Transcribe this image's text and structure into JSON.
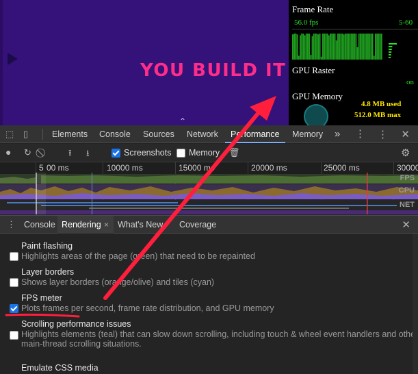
{
  "page": {
    "hero_text": "YOU BUILD IT"
  },
  "fps_meter": {
    "frame_rate_title": "Frame Rate",
    "fps_value": "56.0 fps",
    "fps_range": "5-60",
    "gpu_raster_title": "GPU Raster",
    "gpu_raster_status": "on",
    "gpu_memory_title": "GPU Memory",
    "memory_used": "4.8 MB used",
    "memory_max": "512.0 MB max",
    "fps_history": [
      59,
      60,
      60,
      59,
      34,
      58,
      60,
      60,
      58,
      60,
      60,
      60,
      35,
      57,
      60,
      60,
      60,
      59,
      60,
      33,
      60,
      60,
      60,
      60,
      58,
      60,
      60,
      60,
      60,
      52,
      60,
      60,
      60,
      60,
      59,
      60,
      60,
      60,
      60,
      60,
      60,
      60,
      60,
      44,
      60,
      60,
      60,
      60,
      60,
      60,
      60,
      60,
      60,
      60,
      34,
      60,
      60,
      60,
      60,
      60
    ]
  },
  "devtools": {
    "tabs": [
      {
        "label": "Elements"
      },
      {
        "label": "Console"
      },
      {
        "label": "Sources"
      },
      {
        "label": "Network"
      },
      {
        "label": "Performance"
      },
      {
        "label": "Memory"
      }
    ],
    "more_tabs": "»",
    "active_tab": "Performance"
  },
  "performance": {
    "screenshots_label": "Screenshots",
    "screenshots_checked": true,
    "memory_label": "Memory",
    "memory_checked": false,
    "timeline_ticks": [
      "5",
      "00 ms",
      "10000 ms",
      "15000 ms",
      "20000 ms",
      "25000 ms",
      "30000"
    ],
    "overview_labels": [
      "FPS",
      "CPU",
      "NET"
    ]
  },
  "drawer": {
    "tabs": [
      {
        "label": "Console"
      },
      {
        "label": "Rendering"
      },
      {
        "label": "What's New"
      },
      {
        "label": "Coverage"
      }
    ],
    "active_tab": "Rendering",
    "close_tab_glyph": "×"
  },
  "rendering": {
    "options": [
      {
        "title": "Paint flashing",
        "desc": [
          "Highlights areas of the page (green) that need to be repainted"
        ],
        "checked": false
      },
      {
        "title": "Layer borders",
        "desc": [
          "Shows layer borders (orange/olive) and tiles (cyan)"
        ],
        "checked": false
      },
      {
        "title": "FPS meter",
        "desc": [
          "Plots frames per second, frame rate distribution, and GPU memory"
        ],
        "checked": true
      },
      {
        "title": "Scrolling performance issues",
        "desc": [
          "Highlights elements (teal) that can slow down scrolling, including touch & wheel event handlers and other",
          "main-thread scrolling situations."
        ],
        "checked": false
      }
    ],
    "emulate_css_media": "Emulate CSS media"
  },
  "colors": {
    "accent": "#1a73e8",
    "annotation": "#ff1f3d",
    "hero": "#ff2d8a",
    "fps_green": "#27e027",
    "memory_yellow": "#ffe600"
  }
}
